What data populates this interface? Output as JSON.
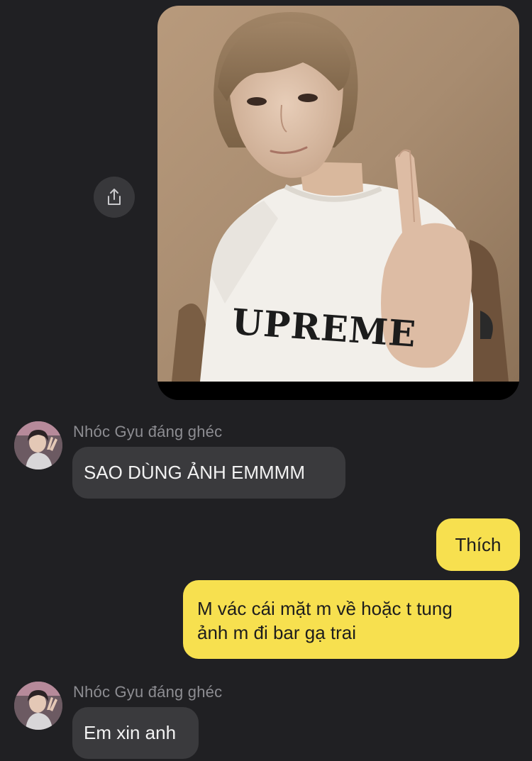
{
  "colors": {
    "background": "#202023",
    "incoming_bubble": "#3a3a3d",
    "outgoing_bubble": "#f7e04f",
    "sender_name": "#8d8d92"
  },
  "photo_message": {
    "shirt_text": "UPREME",
    "share_icon": "share-icon"
  },
  "messages": [
    {
      "direction": "incoming",
      "sender": "Nhóc Gyu đáng ghéc",
      "text": "SAO DÙNG ẢNH EMMMM"
    },
    {
      "direction": "outgoing",
      "text": "Thích"
    },
    {
      "direction": "outgoing",
      "line1": "M vác cái mặt m về hoặc t tung",
      "line2": "ảnh m đi bar gạ trai"
    },
    {
      "direction": "incoming",
      "sender": "Nhóc Gyu đáng ghéc",
      "text": "Em xin anh"
    }
  ]
}
